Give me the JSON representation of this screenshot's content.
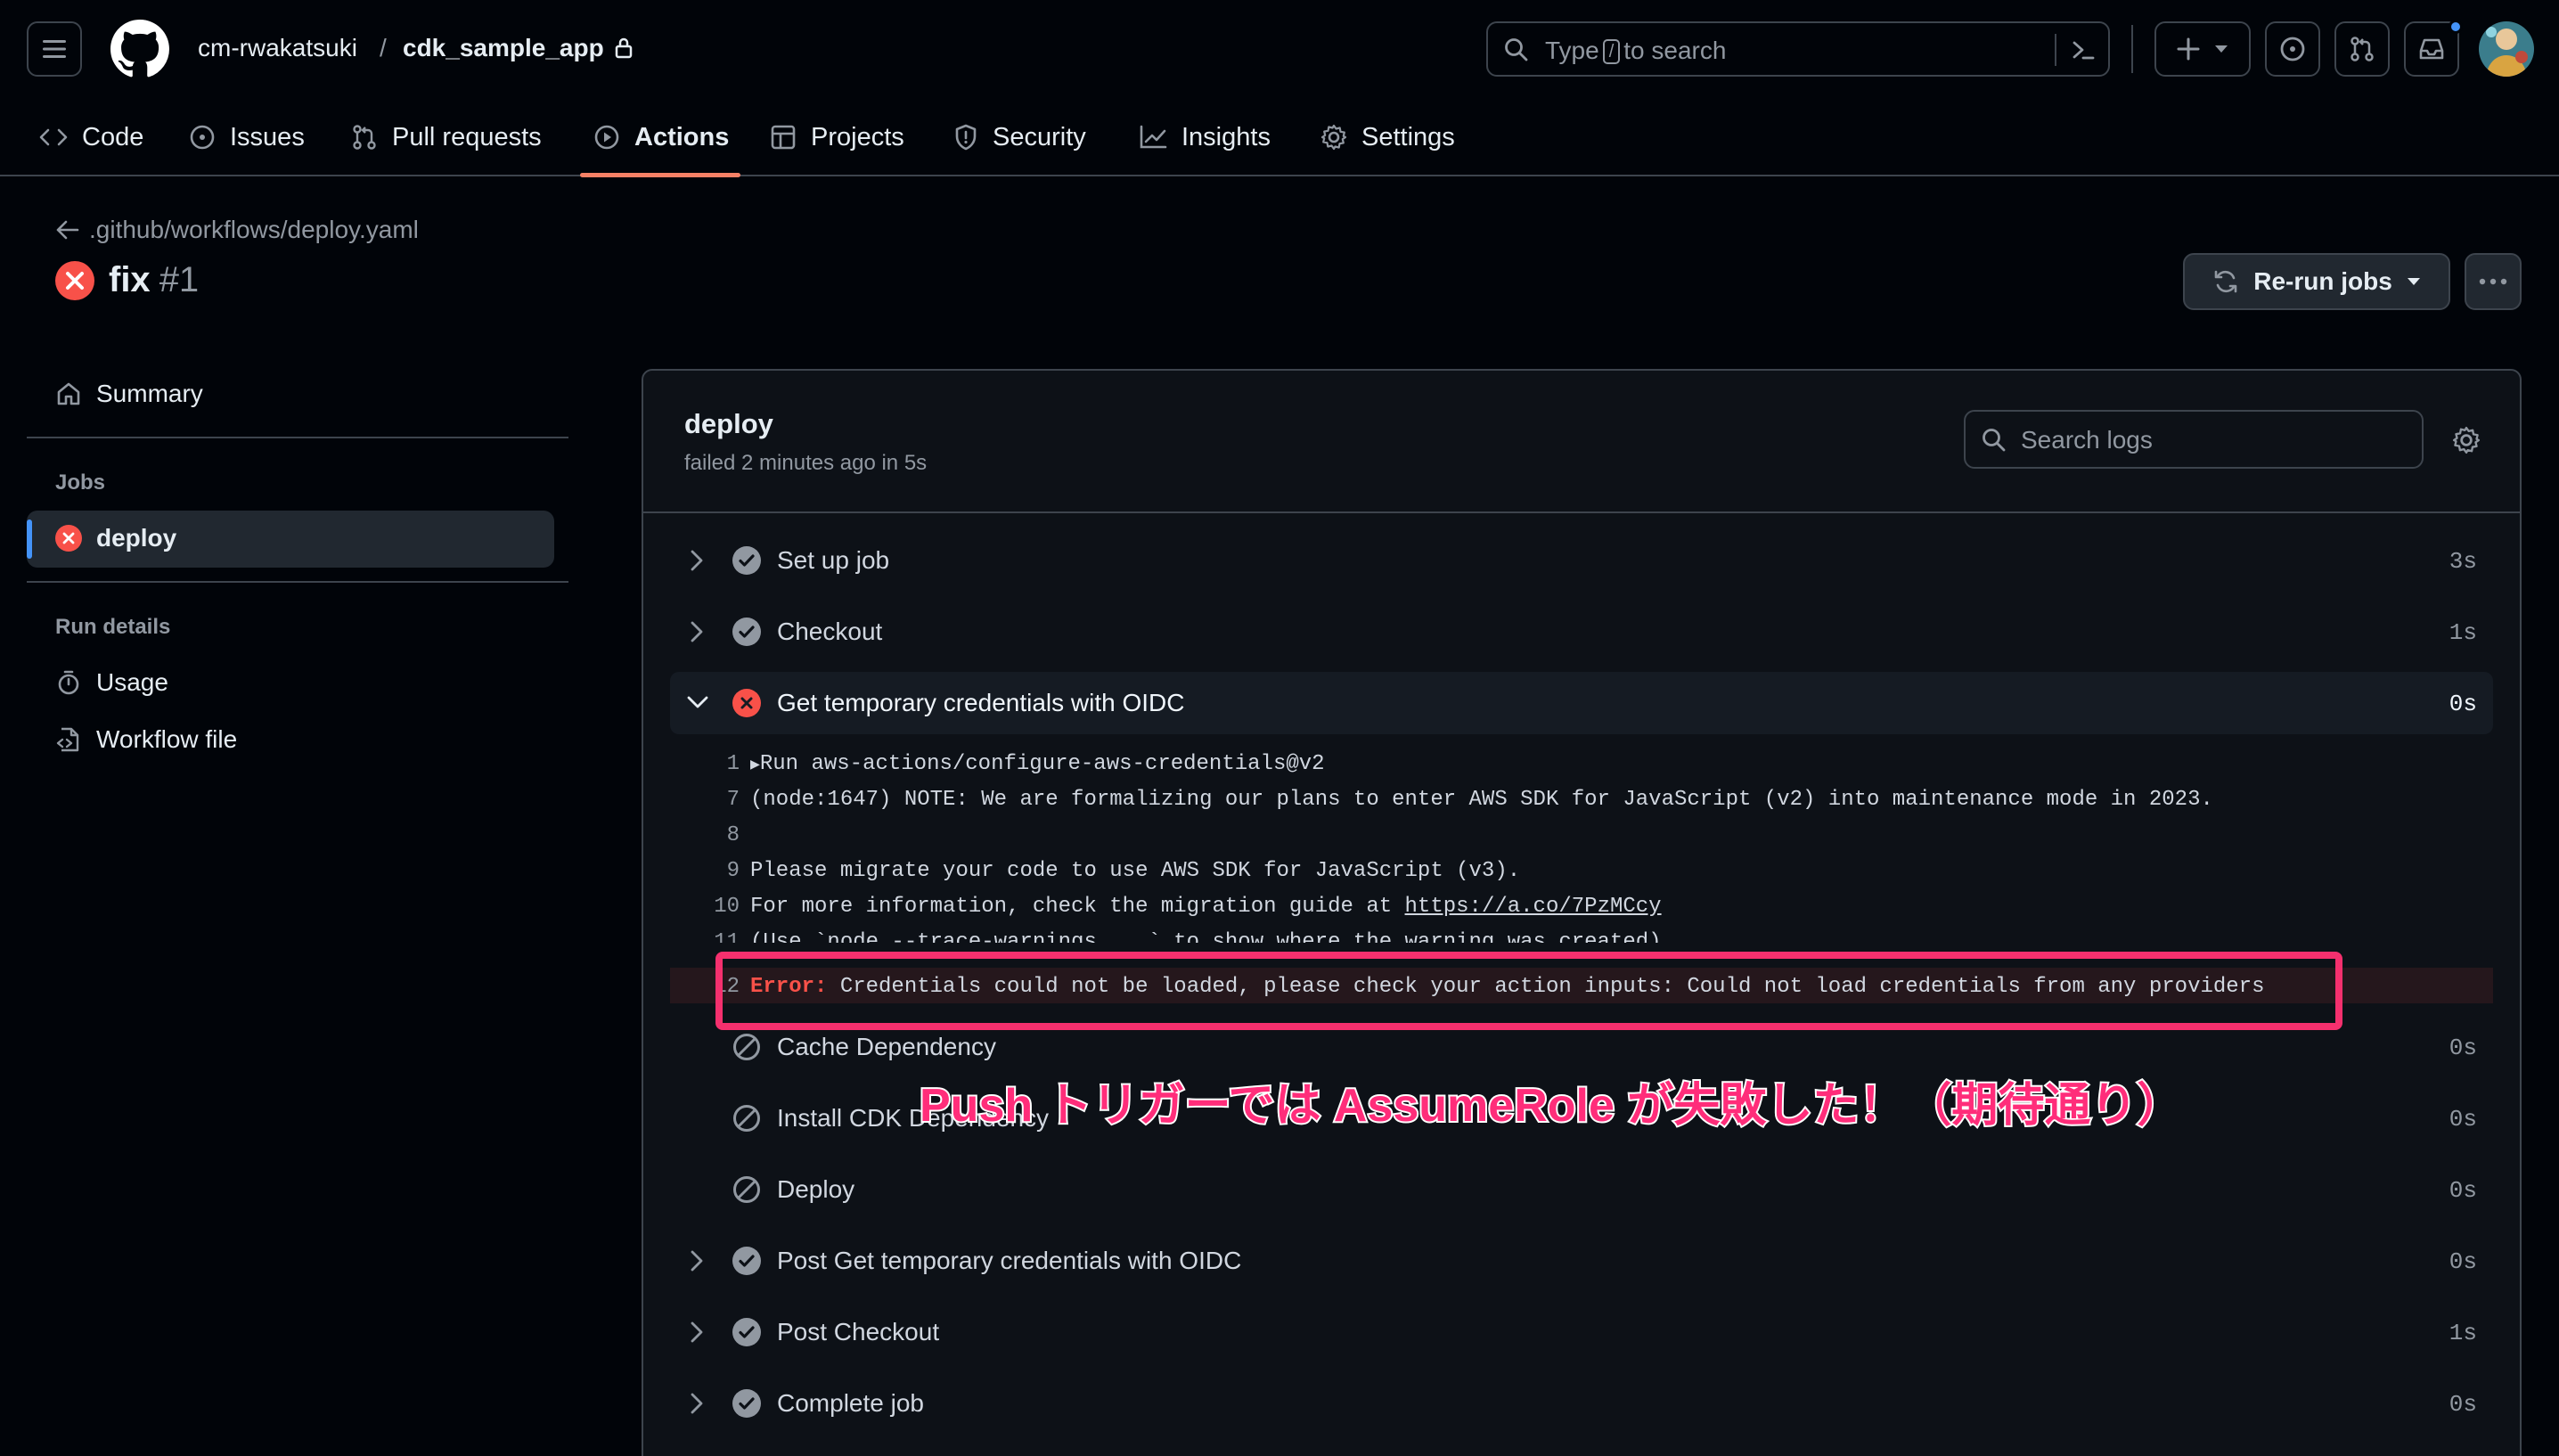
{
  "header": {
    "owner": "cm-rwakatsuki",
    "separator": "/",
    "repo": "cdk_sample_app",
    "search_placeholder_before": "Type",
    "search_key": "/",
    "search_placeholder_after": "to search"
  },
  "nav": {
    "tabs": [
      {
        "label": "Code",
        "icon": "code-icon"
      },
      {
        "label": "Issues",
        "icon": "issue-icon"
      },
      {
        "label": "Pull requests",
        "icon": "pull-request-icon"
      },
      {
        "label": "Actions",
        "icon": "play-icon",
        "active": true
      },
      {
        "label": "Projects",
        "icon": "table-icon"
      },
      {
        "label": "Security",
        "icon": "shield-icon"
      },
      {
        "label": "Insights",
        "icon": "graph-icon"
      },
      {
        "label": "Settings",
        "icon": "gear-icon"
      }
    ]
  },
  "run": {
    "workflow_path": ".github/workflows/deploy.yaml",
    "title": "fix",
    "number": "#1",
    "rerun_label": "Re-run jobs"
  },
  "sidebar": {
    "summary_label": "Summary",
    "jobs_heading": "Jobs",
    "jobs": [
      {
        "label": "deploy",
        "status": "failed"
      }
    ],
    "run_details_heading": "Run details",
    "usage_label": "Usage",
    "workflow_file_label": "Workflow file"
  },
  "job": {
    "name": "deploy",
    "meta": "failed 2 minutes ago in 5s",
    "search_placeholder": "Search logs",
    "steps": [
      {
        "name": "Set up job",
        "duration": "3s",
        "status": "success"
      },
      {
        "name": "Checkout",
        "duration": "1s",
        "status": "success"
      },
      {
        "name": "Get temporary credentials with OIDC",
        "duration": "0s",
        "status": "failed"
      },
      {
        "name": "Cache Dependency",
        "duration": "0s",
        "status": "skipped"
      },
      {
        "name": "Install CDK Dependency",
        "duration": "0s",
        "status": "skipped"
      },
      {
        "name": "Deploy",
        "duration": "0s",
        "status": "skipped"
      },
      {
        "name": "Post Get temporary credentials with OIDC",
        "duration": "0s",
        "status": "success"
      },
      {
        "name": "Post Checkout",
        "duration": "1s",
        "status": "success"
      },
      {
        "name": "Complete job",
        "duration": "0s",
        "status": "success"
      }
    ],
    "log": [
      {
        "n": "1",
        "text": "Run aws-actions/configure-aws-credentials@v2"
      },
      {
        "n": "7",
        "text": "(node:1647) NOTE: We are formalizing our plans to enter AWS SDK for JavaScript (v2) into maintenance mode in 2023."
      },
      {
        "n": "8",
        "text": ""
      },
      {
        "n": "9",
        "text": "Please migrate your code to use AWS SDK for JavaScript (v3)."
      },
      {
        "n": "10",
        "text": "For more information, check the migration guide at ",
        "link": "https://a.co/7PzMCcy"
      },
      {
        "n": "11",
        "text": "(Use `node --trace-warnings ...` to show where the warning was created)"
      },
      {
        "n": "12",
        "keyword": "Error:",
        "text": " Credentials could not be loaded, please check your action inputs: Could not load credentials from any providers"
      }
    ]
  },
  "annotation": {
    "text": "Push トリガーでは AssumeRole が失敗した！（期待通り）",
    "color": "#ff2d7a"
  }
}
